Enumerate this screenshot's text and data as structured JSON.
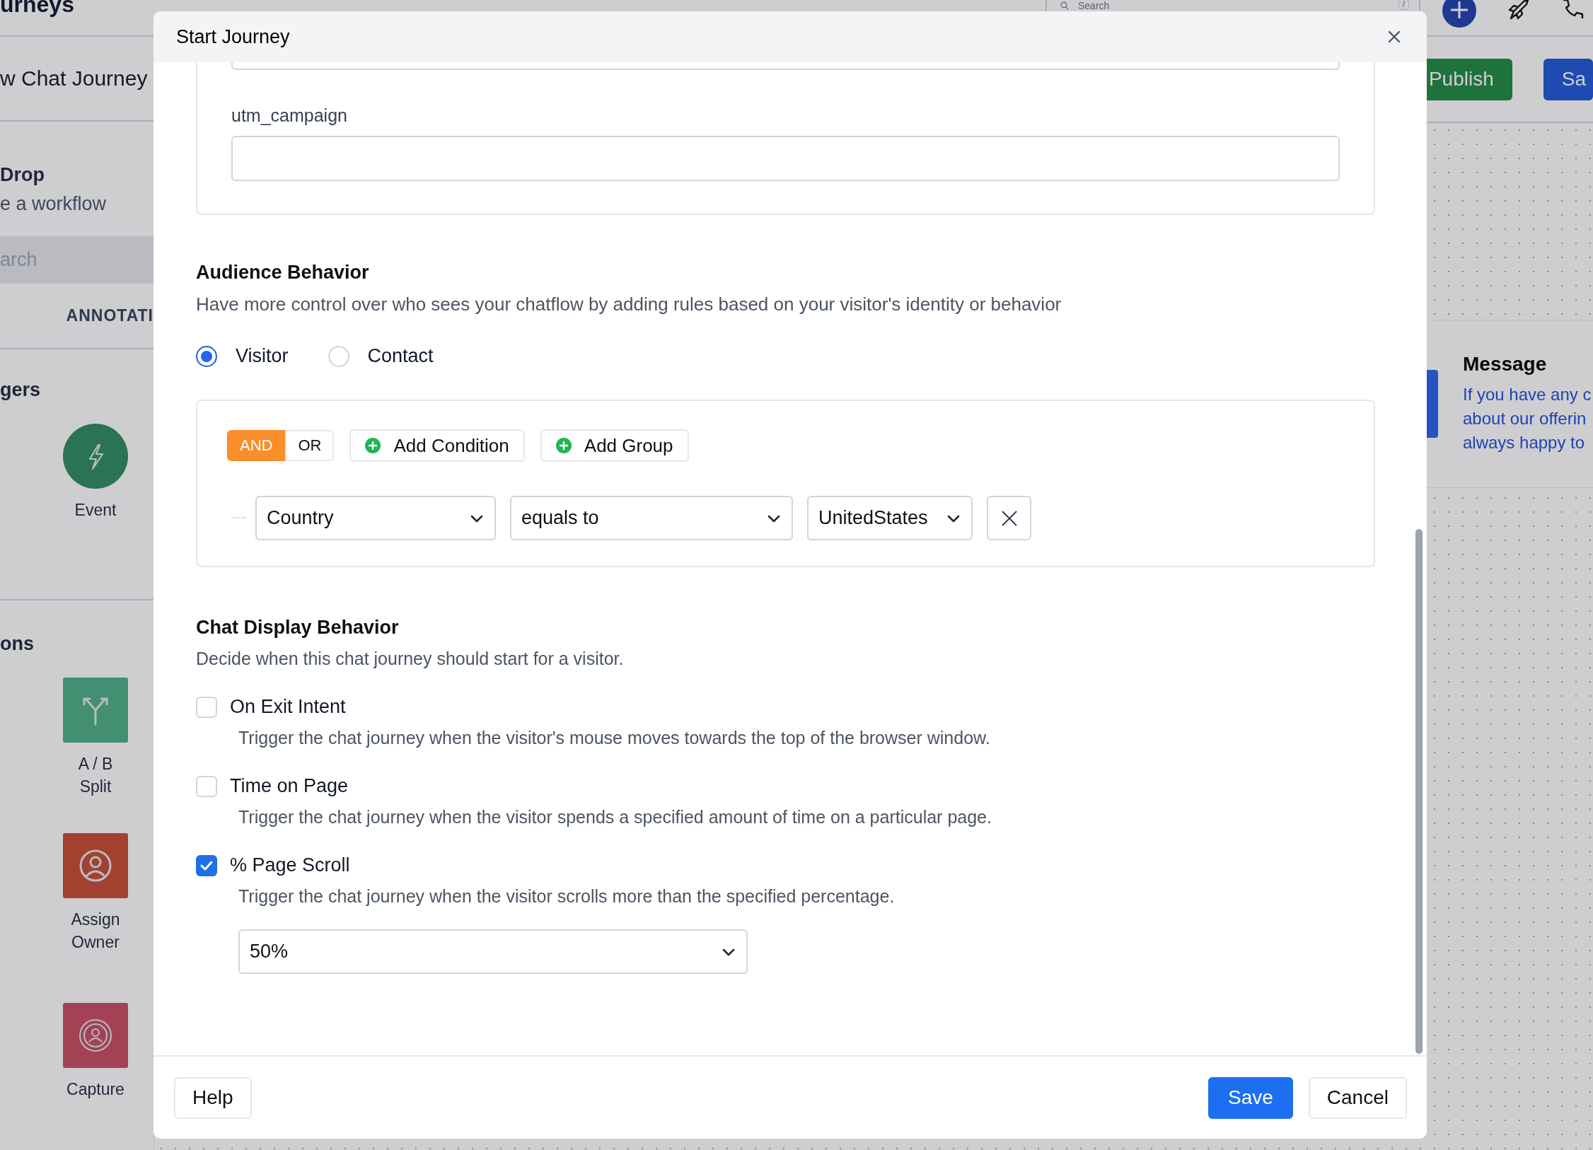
{
  "app": {
    "title": "urneys",
    "search": {
      "placeholder": "Search",
      "shortcut": "/"
    },
    "journey_title": "w Chat Journey",
    "buttons": [
      {
        "label": "Publish",
        "kind": "publish"
      },
      {
        "label": "Sa",
        "kind": "save"
      }
    ]
  },
  "sidebar": {
    "heading": "Drop",
    "subheading": "e a workflow",
    "search": {
      "placeholder": "arch"
    },
    "tab": "ANNOTATI",
    "sections": [
      {
        "title": "gers",
        "items": [
          {
            "label": "Event",
            "kind": "event"
          }
        ]
      },
      {
        "title": "ons",
        "items": [
          {
            "label": "A / B\nSplit",
            "kind": "split"
          },
          {
            "label": "Assign\nOwner",
            "kind": "owner"
          },
          {
            "label": "Capture",
            "kind": "capture"
          }
        ]
      }
    ]
  },
  "canvas": {
    "node": {
      "title": "Message",
      "text": "If you have any c\nabout our offerin\nalways happy to"
    }
  },
  "modal": {
    "title": "Start Journey",
    "utm": {
      "label": "utm_campaign"
    },
    "audience": {
      "title": "Audience Behavior",
      "description": "Have more control over who sees your chatflow by adding rules based on your visitor's identity or behavior",
      "options": [
        {
          "label": "Visitor",
          "selected": true
        },
        {
          "label": "Contact",
          "selected": false
        }
      ],
      "logic": [
        {
          "label": "AND",
          "selected": true
        },
        {
          "label": "OR",
          "selected": false
        }
      ],
      "actions": [
        {
          "label": "Add Condition"
        },
        {
          "label": "Add Group"
        }
      ],
      "conditions": [
        {
          "field": "Country",
          "operator": "equals to",
          "value": "UnitedStates"
        }
      ]
    },
    "display": {
      "title": "Chat Display Behavior",
      "description": "Decide when this chat journey should start for a visitor.",
      "triggers": [
        {
          "label": "On Exit Intent",
          "checked": false,
          "description": "Trigger the chat journey when the visitor's mouse moves towards the top of the browser window."
        },
        {
          "label": "Time on Page",
          "checked": false,
          "description": "Trigger the chat journey when the visitor spends a specified amount of time on a particular page."
        },
        {
          "label": "% Page Scroll",
          "checked": true,
          "description": "Trigger the chat journey when the visitor scrolls more than the specified percentage.",
          "select": {
            "value": "50%"
          }
        }
      ]
    },
    "footer": {
      "help": "Help",
      "save": "Save",
      "cancel": "Cancel"
    }
  }
}
